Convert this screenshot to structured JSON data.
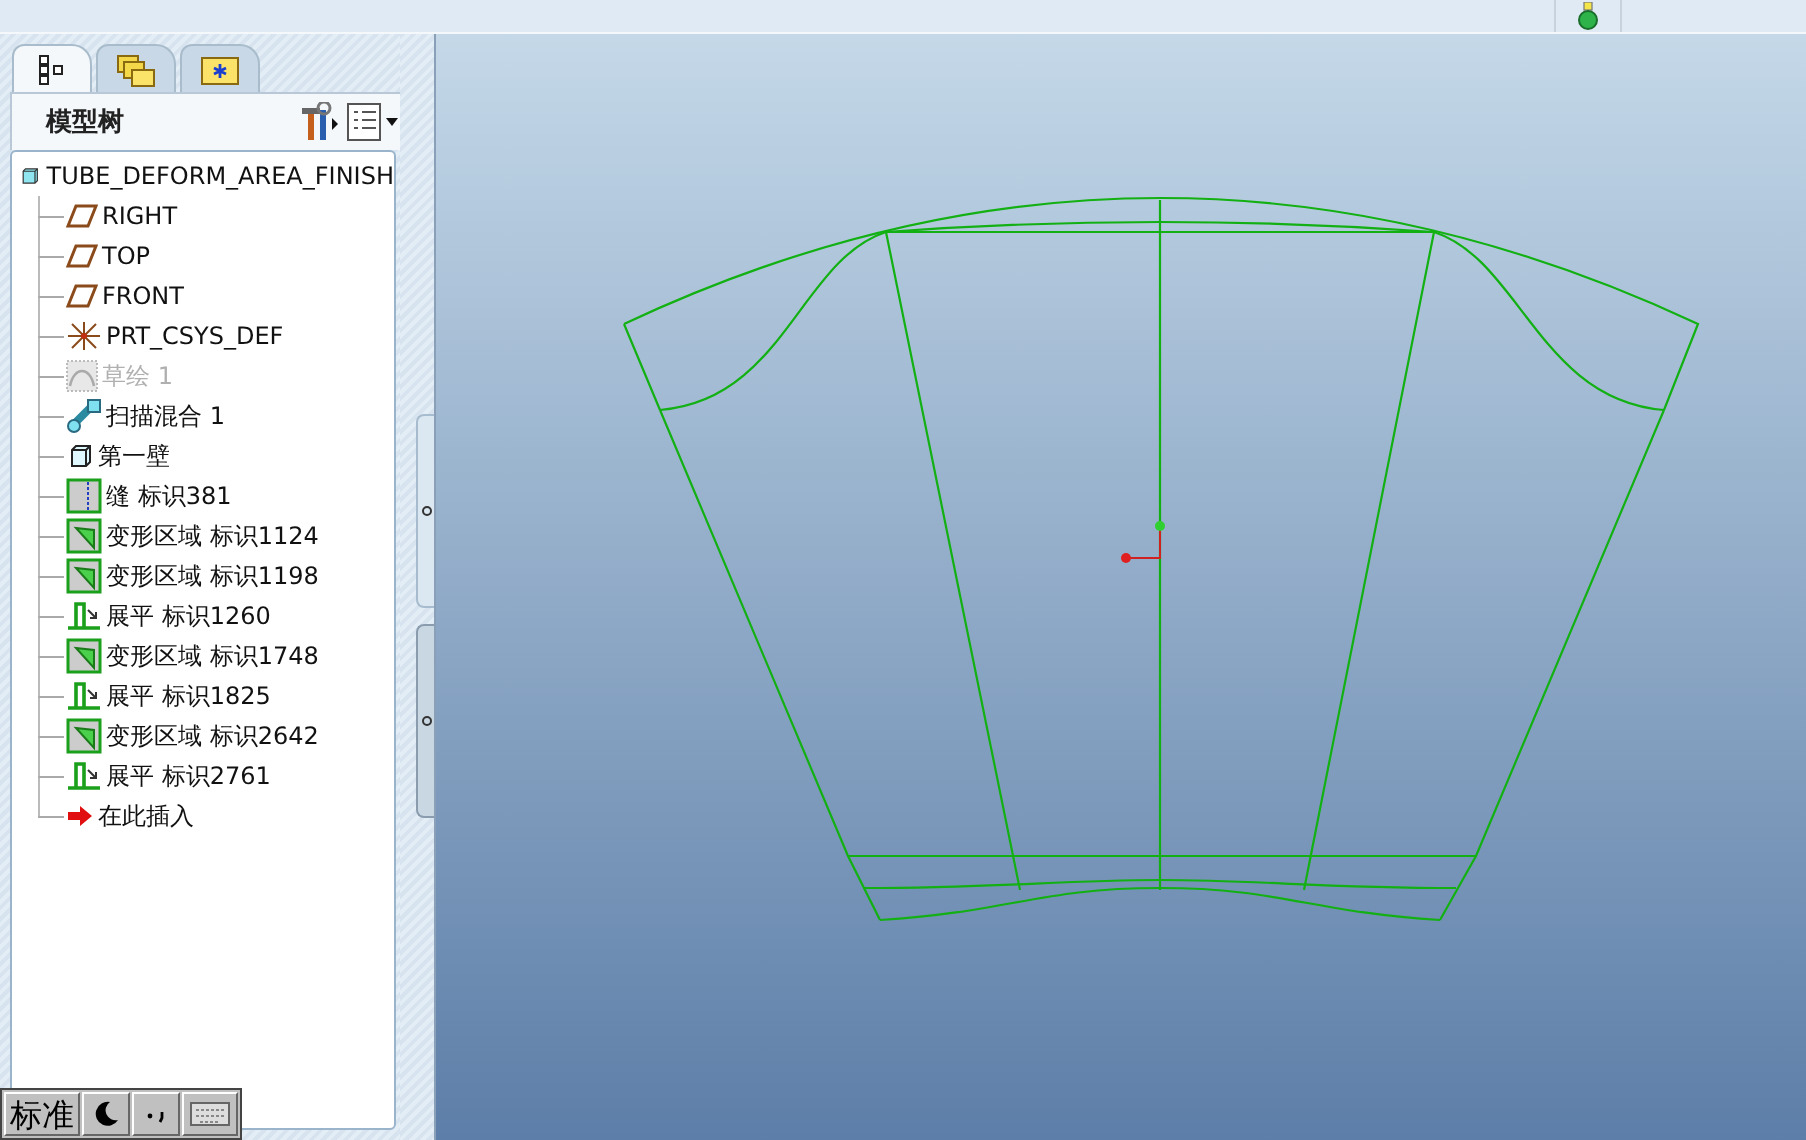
{
  "panel_tabs": [
    {
      "kind": "tree",
      "selected": true
    },
    {
      "kind": "folders",
      "selected": false
    },
    {
      "kind": "favorites",
      "selected": false
    }
  ],
  "panel": {
    "title": "模型树"
  },
  "model_tree": {
    "label": "TUBE_DEFORM_AREA_FINISH",
    "expanded": true,
    "children": [
      {
        "kind": "datum-plane",
        "label": "RIGHT",
        "disabled": false
      },
      {
        "kind": "datum-plane",
        "label": "TOP",
        "disabled": false
      },
      {
        "kind": "datum-plane",
        "label": "FRONT",
        "disabled": false
      },
      {
        "kind": "csys",
        "label": "PRT_CSYS_DEF",
        "disabled": false
      },
      {
        "kind": "sketch",
        "label": "草绘 1",
        "disabled": true
      },
      {
        "kind": "sweep-blend",
        "label": "扫描混合 1",
        "disabled": false
      },
      {
        "kind": "wall",
        "label": "第一壁",
        "disabled": false
      },
      {
        "kind": "rip",
        "label": "缝 标识381",
        "disabled": false
      },
      {
        "kind": "deform-area",
        "label": "变形区域 标识1124",
        "disabled": false
      },
      {
        "kind": "deform-area",
        "label": "变形区域 标识1198",
        "disabled": false
      },
      {
        "kind": "flatten",
        "label": "展平 标识1260",
        "disabled": false
      },
      {
        "kind": "deform-area",
        "label": "变形区域 标识1748",
        "disabled": false
      },
      {
        "kind": "flatten",
        "label": "展平 标识1825",
        "disabled": false
      },
      {
        "kind": "deform-area",
        "label": "变形区域 标识2642",
        "disabled": false
      },
      {
        "kind": "flatten",
        "label": "展平 标识2761",
        "disabled": false
      },
      {
        "kind": "insert",
        "label": "在此插入",
        "disabled": false
      }
    ]
  },
  "ime_bar": {
    "mode": "标准"
  }
}
